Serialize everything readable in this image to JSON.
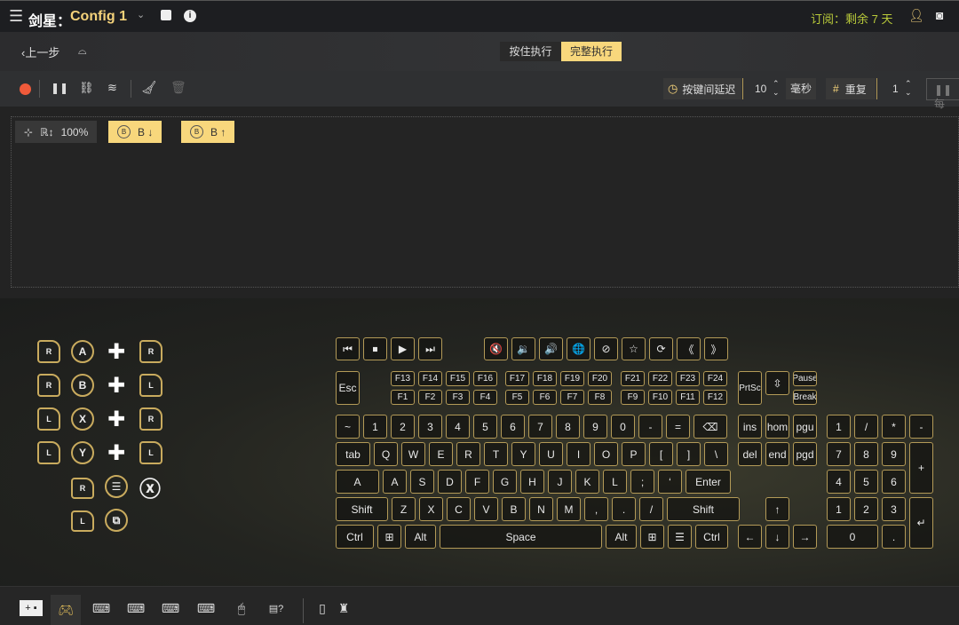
{
  "header": {
    "title_prefix": "剑星：",
    "config": "Config 1",
    "subscription": "订阅：剩余 7 天"
  },
  "nav": {
    "back": "上一步",
    "modes": [
      "按住执行",
      "完整执行"
    ],
    "active_mode": "完整执行"
  },
  "toolbar": {
    "delay_label": "按键间延迟",
    "delay_value": "10",
    "delay_unit": "毫秒",
    "repeat_label": "重复",
    "repeat_value": "1",
    "each_label": "每"
  },
  "macro": {
    "zoom": "100%",
    "steps": [
      {
        "button": "B",
        "label": "B ↓"
      },
      {
        "button": "B",
        "label": "B ↑"
      }
    ]
  },
  "gamepad": {
    "face": [
      "A",
      "B",
      "X",
      "Y"
    ],
    "bumpers": [
      "R",
      "L",
      "R",
      "L"
    ],
    "sticks": [
      "R",
      "R",
      "L",
      "L"
    ],
    "triggers": [
      "R",
      "L"
    ]
  },
  "keyboard": {
    "media": [
      "⏮",
      "⏹",
      "▶",
      "⏭",
      "🔇",
      "🔉",
      "🔊",
      "🌐",
      "⊘",
      "☆",
      "⟳",
      "《",
      "》"
    ],
    "esc": "Esc",
    "fn_top": [
      "F13",
      "F14",
      "F15",
      "F16",
      "F17",
      "F18",
      "F19",
      "F20",
      "F21",
      "F22",
      "F23",
      "F24"
    ],
    "fn_bottom": [
      "F1",
      "F2",
      "F3",
      "F4",
      "F5",
      "F6",
      "F7",
      "F8",
      "F9",
      "F10",
      "F11",
      "F12"
    ],
    "sys": [
      "PrtSc",
      "⇳",
      "Pause",
      "Break"
    ],
    "row1": [
      "~",
      "1",
      "2",
      "3",
      "4",
      "5",
      "6",
      "7",
      "8",
      "9",
      "0",
      "-",
      "=",
      "⌫"
    ],
    "row2": [
      "tab",
      "Q",
      "W",
      "E",
      "R",
      "T",
      "Y",
      "U",
      "I",
      "O",
      "P",
      "[",
      "]",
      "\\"
    ],
    "row3": [
      "A",
      "A",
      "S",
      "D",
      "F",
      "G",
      "H",
      "J",
      "K",
      "L",
      ";",
      "‘",
      "Enter"
    ],
    "row4": [
      "Shift",
      "Z",
      "X",
      "C",
      "V",
      "B",
      "N",
      "M",
      ",",
      ".",
      "/",
      "Shift"
    ],
    "row5": [
      "Ctrl",
      "⊞",
      "Alt",
      "Space",
      "Alt",
      "⊞",
      "☰",
      "Ctrl"
    ],
    "nav": [
      "ins",
      "hom",
      "pgu",
      "del",
      "end",
      "pgd",
      "↑",
      "←",
      "↓",
      "→"
    ],
    "numpad": [
      "1",
      "/",
      "*",
      "-",
      "7",
      "8",
      "9",
      "+",
      "4",
      "5",
      "6",
      "1",
      "2",
      "3",
      "↵",
      "0",
      "."
    ]
  }
}
